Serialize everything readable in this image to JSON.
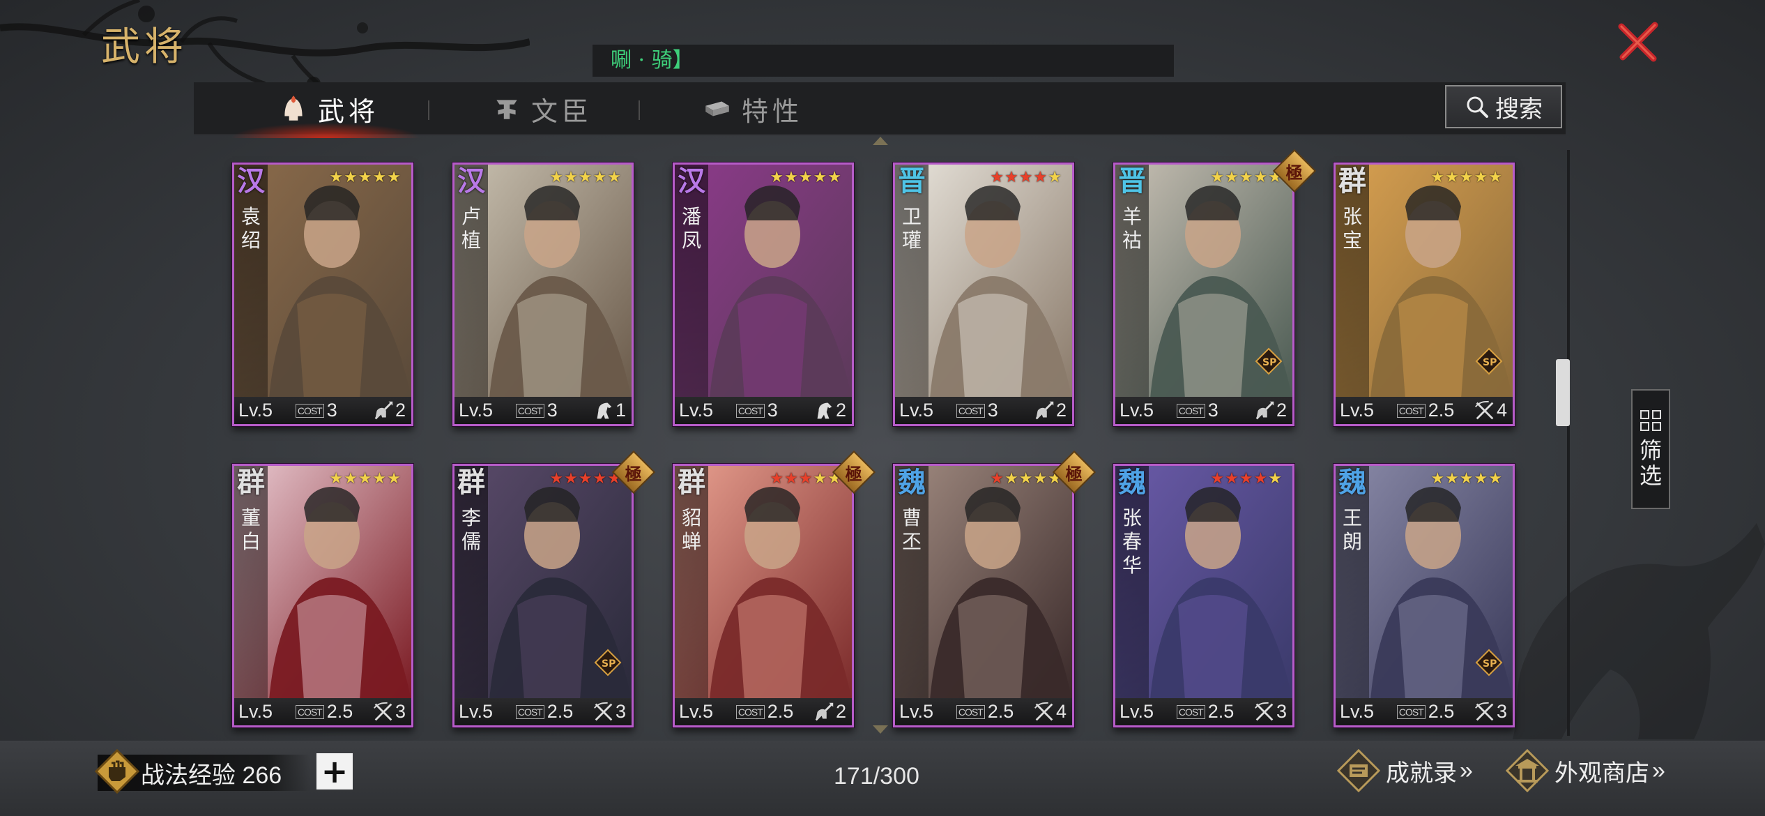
{
  "header": {
    "title": "武将",
    "ticker": "唰 · 骑】",
    "close_icon": "close-x-icon"
  },
  "tabs": [
    {
      "label": "武将",
      "icon": "helmet-icon",
      "active": true
    },
    {
      "label": "文臣",
      "icon": "scholar-icon",
      "active": false
    },
    {
      "label": "特性",
      "icon": "book-icon",
      "active": false
    }
  ],
  "search": {
    "label": "搜索",
    "icon": "search-icon"
  },
  "filter": {
    "label": "筛选",
    "icon": "grid-icon"
  },
  "cards": [
    {
      "faction": "汉",
      "faction_color": "#b979e8",
      "name": "袁绍",
      "level": "Lv.5",
      "cost": "3",
      "unit": "2",
      "stars": 5,
      "red_stars": 0,
      "unit_icon": "cavalry-spear-icon",
      "portrait": "#5a4a3a",
      "accent": "#8a6a4a"
    },
    {
      "faction": "汉",
      "faction_color": "#b979e8",
      "name": "卢植",
      "level": "Lv.5",
      "cost": "3",
      "unit": "1",
      "stars": 5,
      "red_stars": 0,
      "unit_icon": "horse-icon",
      "portrait": "#6a5a4a",
      "accent": "#c8c0b0"
    },
    {
      "faction": "汉",
      "faction_color": "#b979e8",
      "name": "潘凤",
      "level": "Lv.5",
      "cost": "3",
      "unit": "2",
      "stars": 5,
      "red_stars": 0,
      "unit_icon": "horse-icon",
      "portrait": "#5c3a5a",
      "accent": "#8c3a8a"
    },
    {
      "faction": "晋",
      "faction_color": "#4fc4e6",
      "name": "卫瓘",
      "level": "Lv.5",
      "cost": "3",
      "unit": "2",
      "stars": 5,
      "red_stars": 4,
      "unit_icon": "cavalry-spear-icon",
      "portrait": "#8a7a6a",
      "accent": "#e8e4dc"
    },
    {
      "faction": "晋",
      "faction_color": "#4fc4e6",
      "name": "羊祜",
      "level": "Lv.5",
      "cost": "3",
      "unit": "2",
      "stars": 5,
      "red_stars": 0,
      "unit_icon": "cavalry-spear-icon",
      "portrait": "#4a5a52",
      "accent": "#c8c0b4",
      "extreme": "極",
      "sp": true
    },
    {
      "faction": "群",
      "faction_color": "#e0e0e0",
      "name": "张宝",
      "level": "Lv.5",
      "cost": "2.5",
      "unit": "4",
      "stars": 5,
      "red_stars": 0,
      "unit_icon": "crossbow-icon",
      "portrait": "#8a6a3a",
      "accent": "#d8a050",
      "sp": true
    },
    {
      "faction": "群",
      "faction_color": "#e0e0e0",
      "name": "董白",
      "level": "Lv.5",
      "cost": "2.5",
      "unit": "3",
      "stars": 5,
      "red_stars": 0,
      "unit_icon": "crossbow-icon",
      "portrait": "#7a1a22",
      "accent": "#e8c8d0"
    },
    {
      "faction": "群",
      "faction_color": "#e0e0e0",
      "name": "李儒",
      "level": "Lv.5",
      "cost": "2.5",
      "unit": "3",
      "stars": 5,
      "red_stars": 5,
      "unit_icon": "crossbow-icon",
      "portrait": "#2a2a3a",
      "accent": "#5a4a6a",
      "extreme": "極",
      "sp": true
    },
    {
      "faction": "群",
      "faction_color": "#e0e0e0",
      "name": "貂蝉",
      "level": "Lv.5",
      "cost": "2.5",
      "unit": "2",
      "stars": 5,
      "red_stars": 3,
      "unit_icon": "cavalry-spear-icon",
      "portrait": "#7a2a2a",
      "accent": "#e8a090",
      "extreme": "極"
    },
    {
      "faction": "魏",
      "faction_color": "#4fa3e6",
      "name": "曹丕",
      "level": "Lv.5",
      "cost": "2.5",
      "unit": "4",
      "stars": 5,
      "red_stars": 1,
      "unit_icon": "crossbow-icon",
      "portrait": "#3a2a2a",
      "accent": "#a08a80",
      "extreme": "極"
    },
    {
      "faction": "魏",
      "faction_color": "#4fa3e6",
      "name": "张春华",
      "level": "Lv.5",
      "cost": "2.5",
      "unit": "3",
      "stars": 5,
      "red_stars": 4,
      "unit_icon": "crossbow-icon",
      "portrait": "#3a3a6a",
      "accent": "#6a5aa8"
    },
    {
      "faction": "魏",
      "faction_color": "#4fa3e6",
      "name": "王朗",
      "level": "Lv.5",
      "cost": "2.5",
      "unit": "3",
      "stars": 5,
      "red_stars": 0,
      "unit_icon": "crossbow-icon",
      "portrait": "#3a3a5a",
      "accent": "#8a8aa8",
      "sp": true
    }
  ],
  "footer": {
    "exp_label": "战法经验 266",
    "exp_icon": "skill-fist-icon",
    "plus_icon": "plus-icon",
    "count": "171/300",
    "achievements": "成就录",
    "achievements_icon": "achievement-scroll-icon",
    "shop": "外观商店",
    "shop_icon": "pavilion-icon"
  },
  "colors": {
    "card_border": "#b65cc8",
    "accent_gold": "#d7b36b",
    "close_red": "#c8252a"
  }
}
